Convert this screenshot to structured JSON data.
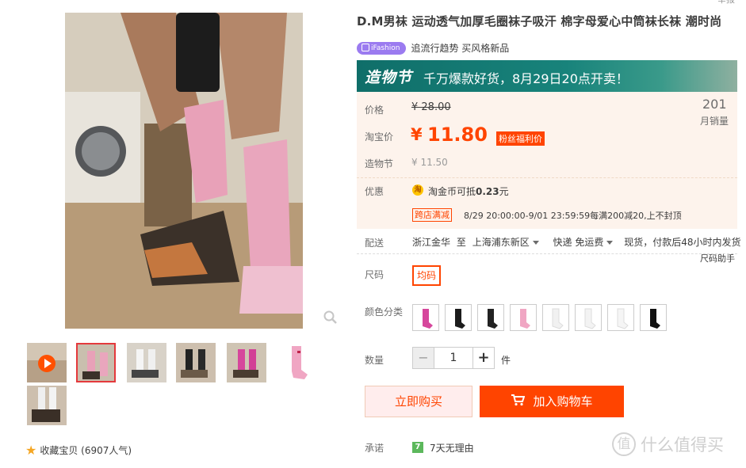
{
  "product": {
    "title": "D.M男袜 运动透气加厚毛圈袜子吸汗 棉字母爱心中筒袜长袜 潮时尚",
    "corner_text": "举报",
    "brand_tag": "iFashion",
    "tag_text": "追流行趋势 买风格新品"
  },
  "banner": {
    "logo": "造物节",
    "slogan": "千万爆款好货，8月29日20点开卖！"
  },
  "price": {
    "orig_label": "价格",
    "orig_value": "¥ 28.00",
    "tb_label": "淘宝价",
    "currency": "¥",
    "tb_value": "11.80",
    "fans_badge": "粉丝福利价",
    "fest_label": "造物节",
    "fest_value": "¥ 11.50",
    "monthly_sales": "201",
    "monthly_sales_label": "月销量"
  },
  "promo": {
    "label": "优惠",
    "coin_icon_text": "淘",
    "coin_text": "淘金币可抵",
    "coin_amount": "0.23",
    "coin_unit": "元",
    "cross_tag": "跨店满减",
    "cross_text": "8/29 20:00:00-9/01 23:59:59每满200减20,上不封顶"
  },
  "shipping": {
    "label": "配送",
    "from": "浙江金华",
    "to_word": "至",
    "to": "上海浦东新区",
    "express": "快递 免运费",
    "stock": "现货，付款后48小时内发货"
  },
  "size": {
    "helper": "尺码助手",
    "label": "尺码",
    "option": "均码"
  },
  "color": {
    "label": "颜色分类"
  },
  "quantity": {
    "label": "数量",
    "minus": "−",
    "value": "1",
    "plus": "+",
    "unit": "件"
  },
  "actions": {
    "buy_now": "立即购买",
    "add_to_cart": "加入购物车"
  },
  "promise": {
    "label": "承诺",
    "icon_text": "7",
    "text": "7天无理由"
  },
  "favorite": {
    "text": "收藏宝贝 (6907人气)"
  },
  "watermark": {
    "icon_text": "值",
    "text": "什么值得买"
  },
  "colors": {
    "accent": "#ff4400",
    "banner": "#0f6e69",
    "price_bg": "#fdf3ec"
  }
}
